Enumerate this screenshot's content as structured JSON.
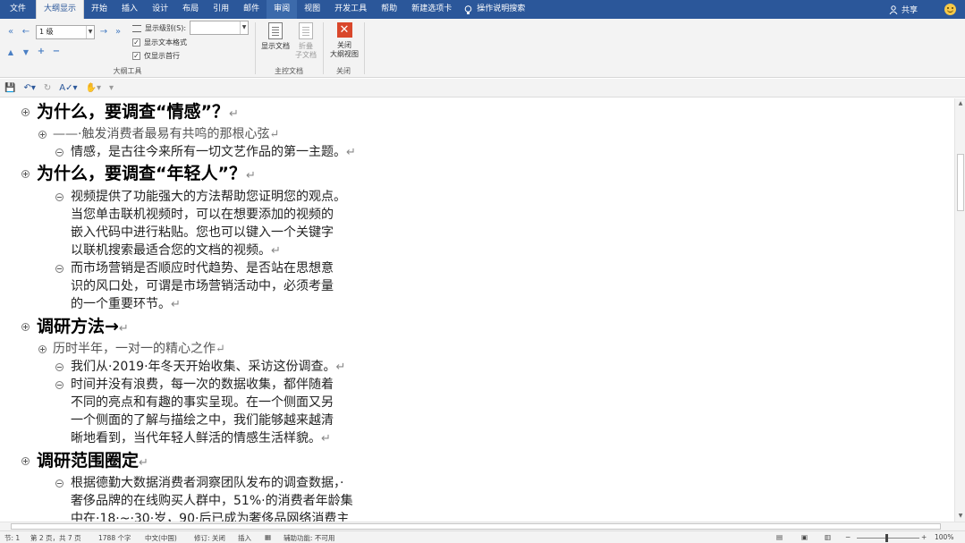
{
  "tabs": [
    "文件",
    "大纲显示",
    "开始",
    "插入",
    "设计",
    "布局",
    "引用",
    "邮件",
    "审阅",
    "视图",
    "开发工具",
    "帮助",
    "新建选项卡"
  ],
  "active_tab": "大纲显示",
  "tell_me": "操作说明搜索",
  "share": "共享",
  "ribbon": {
    "outline_tools": {
      "level_value": "1 级",
      "show_level_label": "显示级别(S):",
      "show_level_value": "",
      "show_text_format": "显示文本格式",
      "show_first_line_only": "仅显示首行",
      "group_label": "大纲工具"
    },
    "master_document": {
      "show_document": "显示文档",
      "collapse_subdocs_line1": "折叠",
      "collapse_subdocs_line2": "子文档",
      "group_label": "主控文档"
    },
    "close": {
      "close_line1": "关闭",
      "close_line2": "大纲视图",
      "group_label": "关闭"
    }
  },
  "document": {
    "paragraphs": [
      {
        "level": 1,
        "text": "为什么，要调查“情感”？",
        "mark": "↵"
      },
      {
        "level": 2,
        "text": "——·触发消费者最易有共鸣的那根心弦",
        "mark": "↵"
      },
      {
        "level": 3,
        "text": "情感，是古往今来所有一切文艺作品的第一主题。",
        "mark": "↵"
      },
      {
        "level": 1,
        "text": "为什么，要调查“年轻人”？",
        "mark": "↵"
      },
      {
        "level": 3,
        "lines": [
          "视频提供了功能强大的方法帮助您证明您的观点。",
          "当您单击联机视频时，可以在想要添加的视频的",
          "嵌入代码中进行粘贴。您也可以键入一个关键字",
          "以联机搜索最适合您的文档的视频。"
        ],
        "mark": "↵"
      },
      {
        "level": 3,
        "lines": [
          "而市场营销是否顺应时代趋势、是否站在思想意",
          "识的风口处，可谓是市场营销活动中，必须考量",
          "的一个重要环节。"
        ],
        "mark": "↵"
      },
      {
        "level": 1,
        "text": "调研方法→",
        "mark": "↵"
      },
      {
        "level": 2,
        "text": "历时半年，一对一的精心之作",
        "mark": "↵"
      },
      {
        "level": 3,
        "text": "我们从·2019·年冬天开始收集、采访这份调查。",
        "mark": "↵"
      },
      {
        "level": 3,
        "lines": [
          "时间并没有浪费，每一次的数据收集，都伴随着",
          "不同的亮点和有趣的事实呈现。在一个侧面又另",
          "一个侧面的了解与描绘之中，我们能够越来越清",
          "晰地看到，当代年轻人鲜活的情感生活样貌。"
        ],
        "mark": "↵"
      },
      {
        "level": 1,
        "text": "调研范围圈定",
        "mark": "↵"
      },
      {
        "level": 3,
        "lines": [
          "根据德勤大数据消费者洞察团队发布的调查数据，·",
          "奢侈品牌的在线购买人群中，51%·的消费者年龄集",
          "中在·18·~·30·岁，90·后已成为奢侈品网络消费主"
        ],
        "mark": ""
      }
    ]
  },
  "status": {
    "section": "节: 1",
    "page": "第 2 页，共 7 页",
    "words": "1788 个字",
    "language": "中文(中国)",
    "track_changes": "修订: 关闭",
    "insert_mode": "插入",
    "accessibility": "辅助功能: 不可用",
    "zoom": "100%"
  },
  "colors": {
    "accent": "#2b579a",
    "ribbon_bg": "#f3f3f3",
    "close_red": "#d9472b"
  }
}
